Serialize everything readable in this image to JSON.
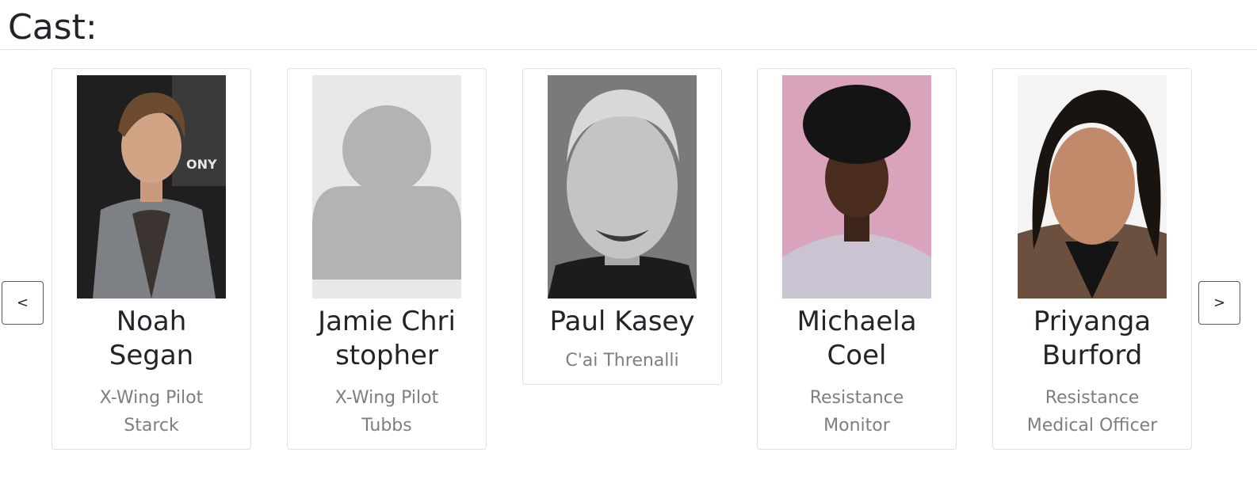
{
  "section": {
    "title": "Cast:"
  },
  "carousel": {
    "prev_label": "<",
    "next_label": ">"
  },
  "cast": [
    {
      "name": "Noah Segan",
      "role": "X-Wing Pilot Starck",
      "photo": "actor-photo"
    },
    {
      "name": "Jamie Christopher",
      "role": "X-Wing Pilot Tubbs",
      "photo": "placeholder-person-icon"
    },
    {
      "name": "Paul Kasey",
      "role": "C'ai Threnalli",
      "photo": "actor-photo"
    },
    {
      "name": "Michaela Coel",
      "role": "Resistance Monitor",
      "photo": "actor-photo"
    },
    {
      "name": "Priyanga Burford",
      "role": "Resistance Medical Officer",
      "photo": "actor-photo"
    }
  ],
  "colors": {
    "title_text": "#212529",
    "role_text": "#7b7f83",
    "card_border": "#dfe2e5",
    "placeholder_bg": "#e8e8e8",
    "placeholder_figure": "#b3b3b3"
  }
}
